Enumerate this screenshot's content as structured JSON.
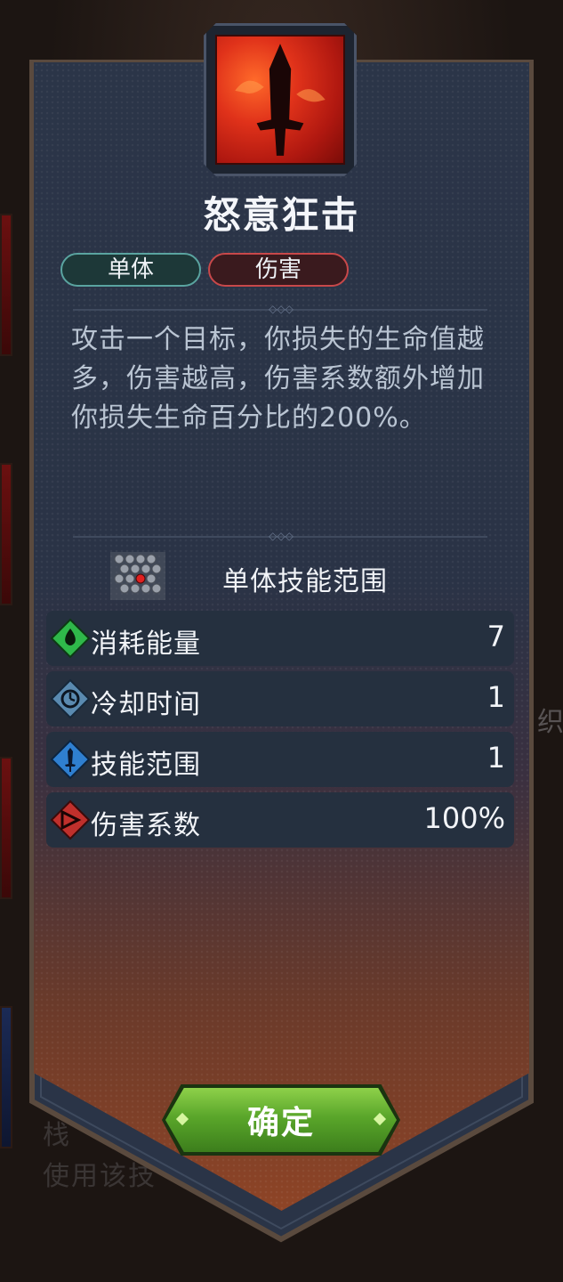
{
  "background": {
    "ghost_right_text": "织",
    "ghost_bottom_line1": "栈",
    "ghost_bottom_line2": "使用该技"
  },
  "skill": {
    "icon": "sword-flame-icon",
    "title": "怒意狂击",
    "tags": [
      "单体",
      "伤害"
    ],
    "description": "攻击一个目标，你损失的生命值越多，伤害越高，伤害系数额外增加你损失生命百分比的200%。"
  },
  "range": {
    "icon": "hex-grid-icon",
    "label": "单体技能范围"
  },
  "stats": [
    {
      "icon": "energy-drop-icon",
      "label": "消耗能量",
      "value": "7",
      "color": "#2fb84a"
    },
    {
      "icon": "clock-icon",
      "label": "冷却时间",
      "value": "1",
      "color": "#5a8ab0"
    },
    {
      "icon": "sword-range-icon",
      "label": "技能范围",
      "value": "1",
      "color": "#2f7fd0"
    },
    {
      "icon": "damage-arrow-icon",
      "label": "伤害系数",
      "value": "100%",
      "color": "#c0302c"
    }
  ],
  "confirm_label": "确定",
  "colors": {
    "tag_single": "#5aa4a0",
    "tag_damage": "#c8484a",
    "confirm": "#5aa62a"
  }
}
